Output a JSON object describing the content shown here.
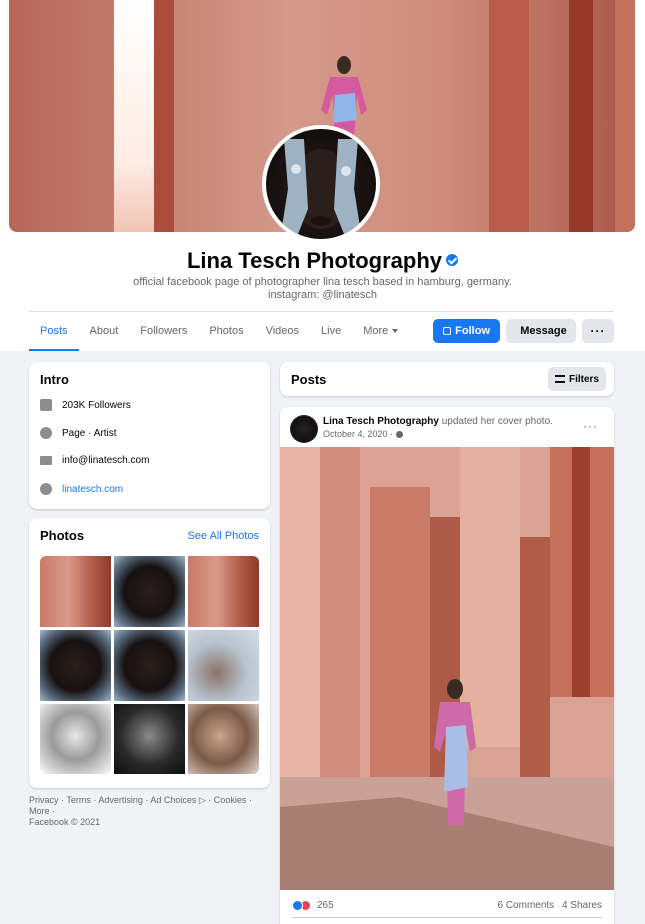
{
  "colors": {
    "accent": "#1877f2",
    "background": "#f0f2f5",
    "secondary_text": "#65676b"
  },
  "profile": {
    "name": "Lina Tesch Photography",
    "bio_line1": "official facebook page of photographer lina tesch based in hamburg, germany.",
    "bio_line2": "instagram: @linatesch",
    "verified_icon": "verified-badge-icon"
  },
  "tabs": [
    "Posts",
    "About",
    "Followers",
    "Photos",
    "Videos",
    "Live",
    "More"
  ],
  "actions": {
    "follow": "Follow",
    "message": "Message",
    "more": "···"
  },
  "intro": {
    "title": "Intro",
    "items": [
      {
        "icon": "followers-icon",
        "text": "203K Followers"
      },
      {
        "icon": "info-icon",
        "text": "Page · Artist"
      },
      {
        "icon": "mail-icon",
        "text": "info@linatesch.com"
      },
      {
        "icon": "globe-icon",
        "text": "linatesch.com"
      }
    ]
  },
  "photos": {
    "title": "Photos",
    "see_all": "See All Photos"
  },
  "footer": {
    "line1": "Privacy · Terms · Advertising · Ad Choices ▷ · Cookies · More ·",
    "line2": "Facebook © 2021"
  },
  "posts": {
    "title": "Posts",
    "filters": "Filters",
    "post": {
      "author": "Lina Tesch Photography",
      "action": "updated her cover photo.",
      "date": "October 4, 2020 ·",
      "reactions_count": "265",
      "comments": "6 Comments",
      "shares": "4 Shares"
    }
  }
}
